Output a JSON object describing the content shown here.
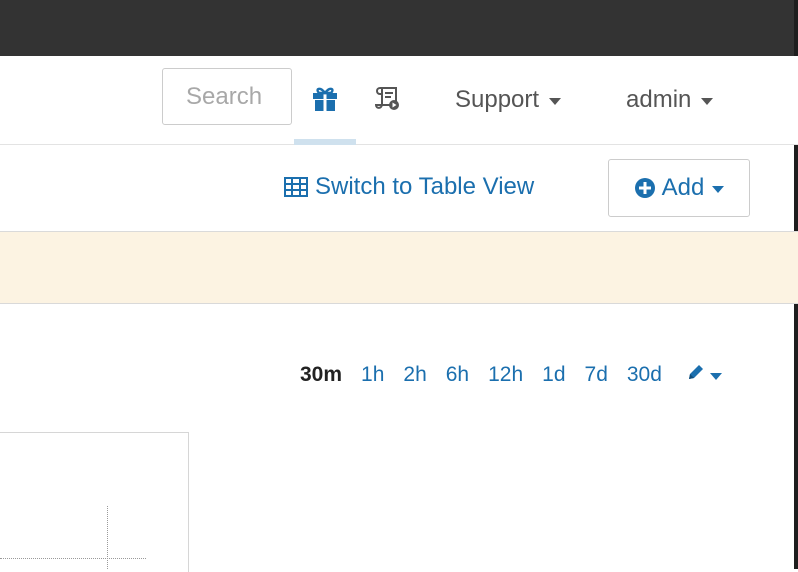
{
  "navbar": {
    "search_placeholder": "Search",
    "gift_icon": "gift-icon",
    "scroll_icon": "scroll-icon",
    "support_label": "Support",
    "admin_label": "admin"
  },
  "toolbar": {
    "table_view_label": "Switch to Table View",
    "table_icon": "table-icon",
    "add_label": "Add",
    "add_icon": "plus-circle-icon"
  },
  "time_ranges": {
    "items": [
      "30m",
      "1h",
      "2h",
      "6h",
      "12h",
      "1d",
      "7d",
      "30d"
    ],
    "selected": "30m",
    "edit_icon": "pencil-icon"
  },
  "colors": {
    "link": "#1b6fae",
    "topbar": "#333333",
    "banner": "#fcf3e2",
    "active_tab_indicator": "#cfe1ee"
  }
}
